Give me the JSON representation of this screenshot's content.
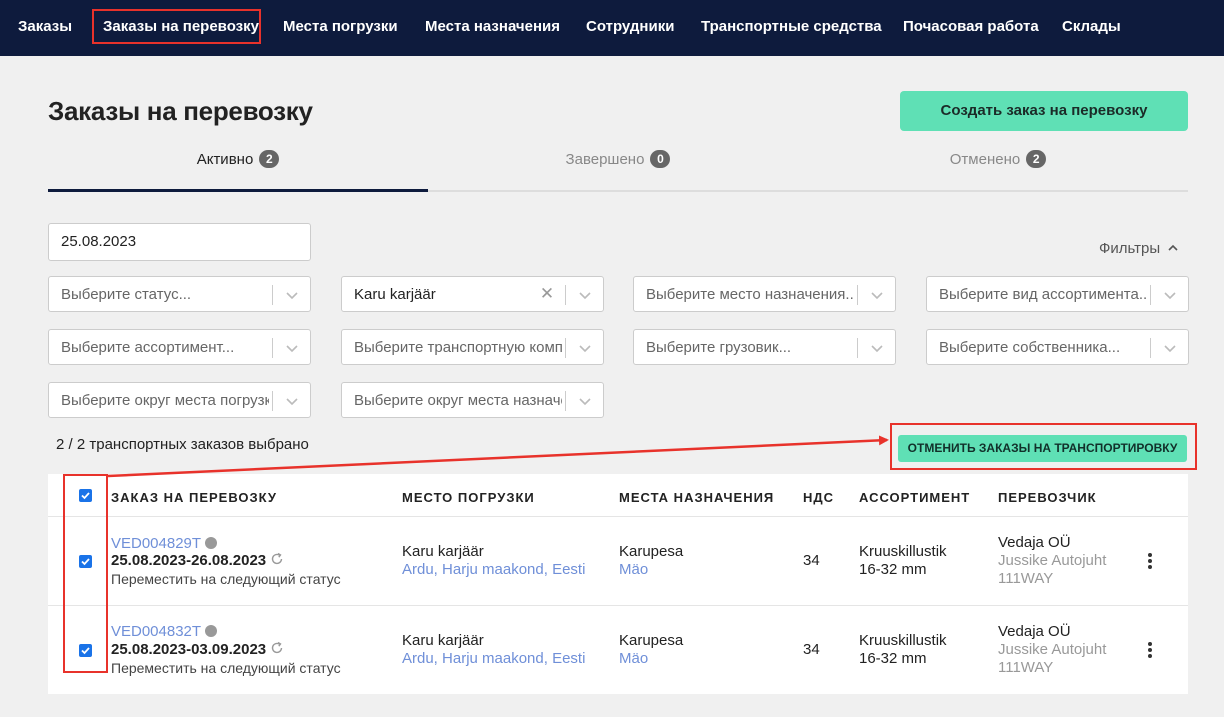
{
  "nav": {
    "items": [
      "Заказы",
      "Заказы на перевозку",
      "Места погрузки",
      "Места назначения",
      "Сотрудники",
      "Транспортные средства",
      "Почасовая работа",
      "Склады"
    ]
  },
  "page": {
    "title": "Заказы на перевозку",
    "create_button": "Создать заказ на перевозку"
  },
  "tabs": [
    {
      "label": "Активно",
      "count": "2",
      "active": true
    },
    {
      "label": "Завершено",
      "count": "0",
      "active": false
    },
    {
      "label": "Отменено",
      "count": "2",
      "active": false
    }
  ],
  "filters": {
    "date": "25.08.2023",
    "toggle_label": "Фильтры",
    "selects": [
      {
        "text": "Выберите статус...",
        "filled": false,
        "clearable": false
      },
      {
        "text": "Karu karjäär",
        "filled": true,
        "clearable": true
      },
      {
        "text": "Выберите место назначения...",
        "filled": false,
        "clearable": false
      },
      {
        "text": "Выберите вид ассортимента...",
        "filled": false,
        "clearable": false
      },
      {
        "text": "Выберите ассортимент...",
        "filled": false,
        "clearable": false
      },
      {
        "text": "Выберите транспортную компанию...",
        "filled": false,
        "clearable": false
      },
      {
        "text": "Выберите грузовик...",
        "filled": false,
        "clearable": false
      },
      {
        "text": "Выберите собственника...",
        "filled": false,
        "clearable": false
      },
      {
        "text": "Выберите округ места погрузки...",
        "filled": false,
        "clearable": false
      },
      {
        "text": "Выберите округ места назначения...",
        "filled": false,
        "clearable": false
      }
    ]
  },
  "selection": {
    "count_text": "2 / 2 транспортных заказов выбрано",
    "cancel_button": "ОТМЕНИТЬ ЗАКАЗЫ НА ТРАНСПОРТИРОВКУ"
  },
  "table": {
    "headers": [
      "ЗАКАЗ НА ПЕРЕВОЗКУ",
      "МЕСТО ПОГРУЗКИ",
      "МЕСТА НАЗНАЧЕНИЯ",
      "НДС",
      "АССОРТИМЕНТ",
      "ПЕРЕВОЗЧИК"
    ],
    "rows": [
      {
        "order_id": "VED004829T",
        "dates": "25.08.2023-26.08.2023",
        "action": "Переместить на следующий статус",
        "loading_place": "Karu karjäär",
        "loading_region": "Ardu, Harju maakond, Eesti",
        "destination": "Karupesa",
        "destination_region": "Mäo",
        "vat": "34",
        "assortment_line1": "Kruuskillustik",
        "assortment_line2": "16-32 mm",
        "carrier": "Vedaja OÜ",
        "driver": "Jussike Autojuht",
        "plate": "111WAY",
        "checked": true
      },
      {
        "order_id": "VED004832T",
        "dates": "25.08.2023-03.09.2023",
        "action": "Переместить на следующий статус",
        "loading_place": "Karu karjäär",
        "loading_region": "Ardu, Harju maakond, Eesti",
        "destination": "Karupesa",
        "destination_region": "Mäo",
        "vat": "34",
        "assortment_line1": "Kruuskillustik",
        "assortment_line2": "16-32 mm",
        "carrier": "Vedaja OÜ",
        "driver": "Jussike Autojuht",
        "plate": "111WAY",
        "checked": true
      }
    ]
  },
  "colors": {
    "nav_bg": "#0e1b3d",
    "accent_green": "#5fe0b5",
    "highlight_red": "#e8322b",
    "link_blue": "#6f8fd8",
    "checkbox_blue": "#1a73e8"
  }
}
